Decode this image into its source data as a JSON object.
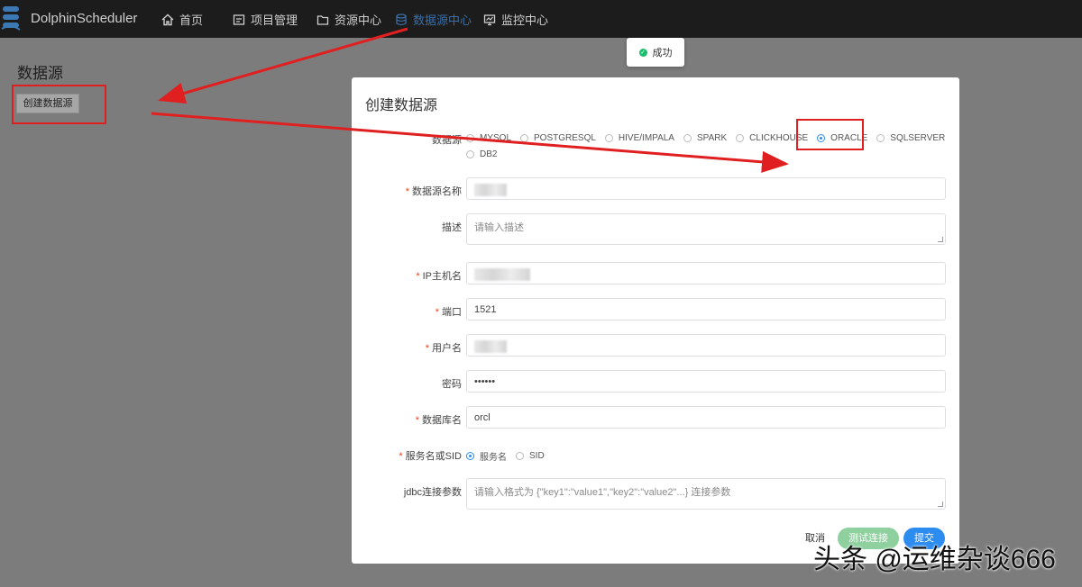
{
  "app": {
    "title": "DolphinScheduler"
  },
  "nav": [
    {
      "label": "首页",
      "icon": "home-icon",
      "active": false
    },
    {
      "label": "项目管理",
      "icon": "project-icon",
      "active": false
    },
    {
      "label": "资源中心",
      "icon": "folder-icon",
      "active": false
    },
    {
      "label": "数据源中心",
      "icon": "database-icon",
      "active": true
    },
    {
      "label": "监控中心",
      "icon": "monitor-icon",
      "active": false
    }
  ],
  "page": {
    "title": "数据源",
    "create_button": "创建数据源"
  },
  "toast": {
    "text": "成功",
    "status": "success"
  },
  "modal": {
    "title": "创建数据源",
    "datasource_label": "数据源",
    "datasource_types": [
      "MYSQL",
      "POSTGRESQL",
      "HIVE/IMPALA",
      "SPARK",
      "CLICKHOUSE",
      "ORACLE",
      "SQLSERVER",
      "DB2"
    ],
    "datasource_selected": "ORACLE",
    "fields": {
      "name": {
        "label": "数据源名称",
        "required": true,
        "value": ""
      },
      "description": {
        "label": "描述",
        "required": false,
        "placeholder": "请输入描述"
      },
      "host": {
        "label": "IP主机名",
        "required": true,
        "value": ""
      },
      "port": {
        "label": "端口",
        "required": true,
        "value": "1521"
      },
      "username": {
        "label": "用户名",
        "required": true,
        "value": ""
      },
      "password": {
        "label": "密码",
        "required": false,
        "value": "••••••"
      },
      "database": {
        "label": "数据库名",
        "required": true,
        "value": "orcl"
      },
      "service": {
        "label": "服务名或SID",
        "required": true,
        "options": [
          "服务名",
          "SID"
        ],
        "selected": "服务名"
      },
      "jdbc": {
        "label": "jdbc连接参数",
        "required": false,
        "placeholder": "请输入格式为 {\"key1\":\"value1\",\"key2\":\"value2\"...} 连接参数"
      }
    },
    "buttons": {
      "cancel": "取消",
      "test": "测试连接",
      "submit": "提交"
    }
  },
  "watermark": "头条 @运维杂谈666",
  "colors": {
    "topbar": "#1c1c1c",
    "active_nav": "#3b6ea6",
    "primary": "#2d8cf0",
    "test_button": "#8fd19e",
    "annotation": "#e02020",
    "required_mark": "#ed4014"
  }
}
